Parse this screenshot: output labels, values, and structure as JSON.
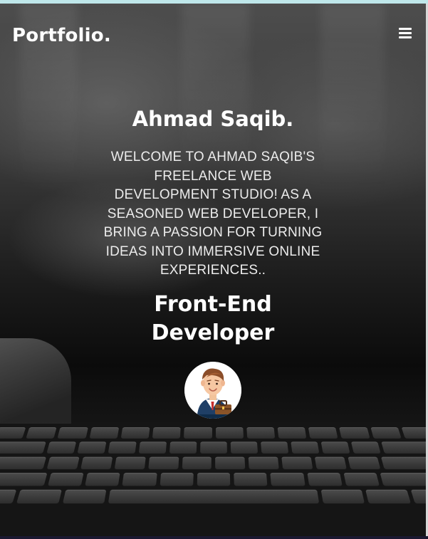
{
  "header": {
    "logo": "Portfolio.",
    "menu_icon": "hamburger-menu-icon"
  },
  "hero": {
    "name": "Ahmad Saqib.",
    "description": "WELCOME TO AHMAD SAQIB'S FREELANCE WEB DEVELOPMENT STUDIO! AS A SEASONED WEB DEVELOPER, I BRING A PASSION FOR TURNING IDEAS INTO IMMERSIVE ONLINE EXPERIENCES..",
    "role": "Front-End Developer",
    "avatar_icon": "businessman-avatar"
  },
  "colors": {
    "top_strip": "#bfe7ea",
    "text": "#ffffff"
  }
}
